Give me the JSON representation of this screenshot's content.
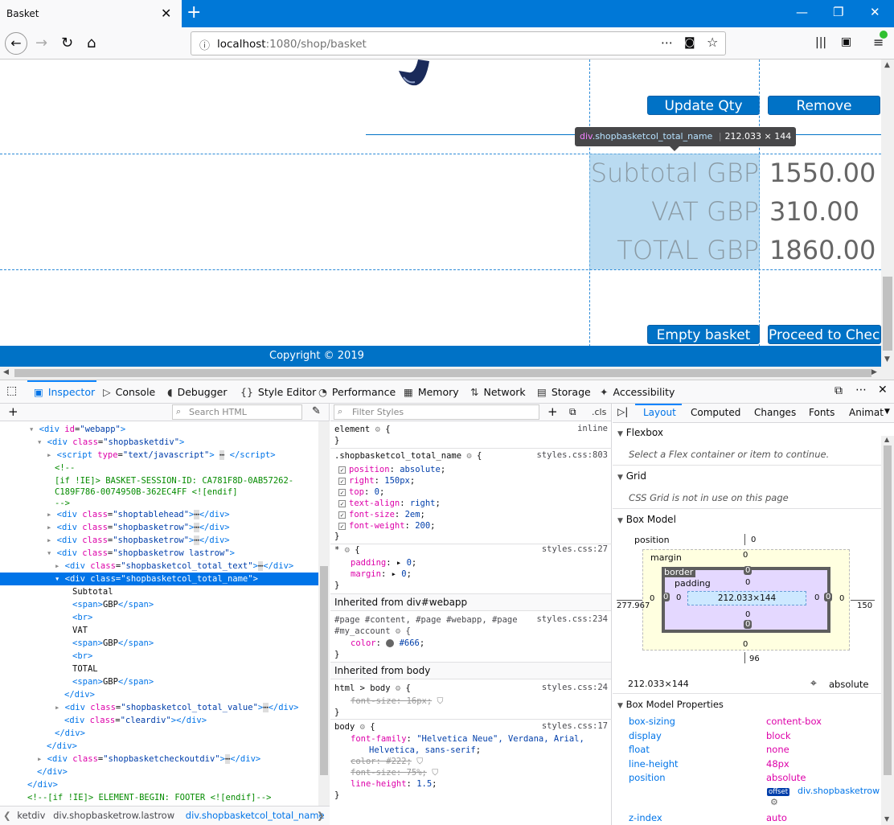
{
  "browser": {
    "tab_title": "Basket",
    "url_host": "localhost",
    "url_rest": ":1080/shop/basket"
  },
  "page": {
    "update_qty": "Update Qty",
    "remove": "Remove",
    "tooltip_tag": "div",
    "tooltip_class": ".shopbasketcol_total_name",
    "tooltip_size": "212.033 × 144",
    "subtotal_label": "Subtotal GBP",
    "vat_label": "VAT GBP",
    "total_label": "TOTAL GBP",
    "subtotal_value": "1550.00",
    "vat_value": "310.00",
    "total_value": "1860.00",
    "empty_basket": "Empty basket",
    "proceed": "Proceed to Check",
    "copyright": "Copyright © 2019"
  },
  "devtools": {
    "tabs": [
      "Inspector",
      "Console",
      "Debugger",
      "Style Editor",
      "Performance",
      "Memory",
      "Network",
      "Storage",
      "Accessibility"
    ],
    "search_html_placeholder": "Search HTML",
    "filter_styles_placeholder": "Filter Styles",
    "cls": ".cls",
    "layout_tabs": [
      "Layout",
      "Computed",
      "Changes",
      "Fonts",
      "Animat"
    ],
    "breadcrumbs": [
      "ketdiv",
      "div.shopbasketrow.lastrow",
      "div.shopbasketcol_total_name"
    ]
  },
  "markup": [
    {
      "indent": 36,
      "arrow": "▾",
      "html": "<span class='tag'>&lt;div</span> <span class='attr'>id</span>=<span class='val'>\"webapp\"</span><span class='tag'>&gt;</span>"
    },
    {
      "indent": 48,
      "arrow": "▾",
      "html": "<span class='tag'>&lt;div</span> <span class='attr'>class</span>=<span class='val'>\"shopbasketdiv\"</span><span class='tag'>&gt;</span>"
    },
    {
      "indent": 60,
      "arrow": "▸",
      "html": "<span class='tag'>&lt;script</span> <span class='attr'>type</span>=<span class='val'>\"text/javascript\"</span><span class='tag'>&gt;</span> ⋯ <span class='tag'>&lt;/script&gt;</span>"
    }
  ],
  "markup_text": {
    "comment1": "<!--",
    "comment2": "[if !IE]> BASKET-SESSION-ID: CA781F8D-0AB57262-",
    "comment3": "C189F786-0074950B-362EC4FF <![endif]",
    "comment4": "-->",
    "subtotal": "Subtotal",
    "vat": "VAT",
    "total": "TOTAL",
    "footer_comment": "<!--[if !IE]> ELEMENT-BEGIN: FOOTER <![endif]-->"
  },
  "rules": {
    "element": "element",
    "inline": "inline",
    "selector": ".shopbasketcol_total_name",
    "src1": "styles.css:803",
    "decls": [
      {
        "p": "position",
        "v": "absolute"
      },
      {
        "p": "right",
        "v": "150px"
      },
      {
        "p": "top",
        "v": "0"
      },
      {
        "p": "text-align",
        "v": "right"
      },
      {
        "p": "font-size",
        "v": "2em"
      },
      {
        "p": "font-weight",
        "v": "200"
      }
    ],
    "star": "*",
    "src2": "styles.css:27",
    "padding": "padding",
    "margin": "margin",
    "zero": "0",
    "inh_webapp": "Inherited from div#webapp",
    "sel_webapp": "#page #content, #page #webapp, #page",
    "sel_webapp2": "#my_account",
    "src3": "styles.css:234",
    "color_prop": "color",
    "color_val": "#666",
    "inh_body": "Inherited from body",
    "sel_htmlbody": "html > body",
    "src4": "styles.css:24",
    "font_size": "font-size",
    "v_16px": "16px",
    "sel_body": "body",
    "src5": "styles.css:17",
    "font_family": "font-family",
    "ff_val1": "\"Helvetica Neue\", Verdana, Arial,",
    "ff_val2": "Helvetica, sans-serif",
    "v_222": "#222",
    "v_75": "75%",
    "line_height": "line-height",
    "v_15": "1.5"
  },
  "layout": {
    "flexbox": "Flexbox",
    "flex_msg": "Select a Flex container or item to continue.",
    "grid": "Grid",
    "grid_msg": "CSS Grid is not in use on this page",
    "box_model": "Box Model",
    "position": "position",
    "margin": "margin",
    "border": "border",
    "padding": "padding",
    "content_size": "212.033×144",
    "left_pos": "277.967",
    "right_pos": "150",
    "top_pos": "0",
    "bottom_pos": "96",
    "size_summary": "212.033×144",
    "pos_summary": "absolute",
    "bmp_title": "Box Model Properties",
    "props": [
      {
        "k": "box-sizing",
        "v": "content-box"
      },
      {
        "k": "display",
        "v": "block"
      },
      {
        "k": "float",
        "v": "none"
      },
      {
        "k": "line-height",
        "v": "48px"
      },
      {
        "k": "position",
        "v": "absolute"
      }
    ],
    "offset": "offset",
    "offset_parent": "div.shopbasketrow",
    "zindex_k": "z-index",
    "zindex_v": "auto"
  }
}
